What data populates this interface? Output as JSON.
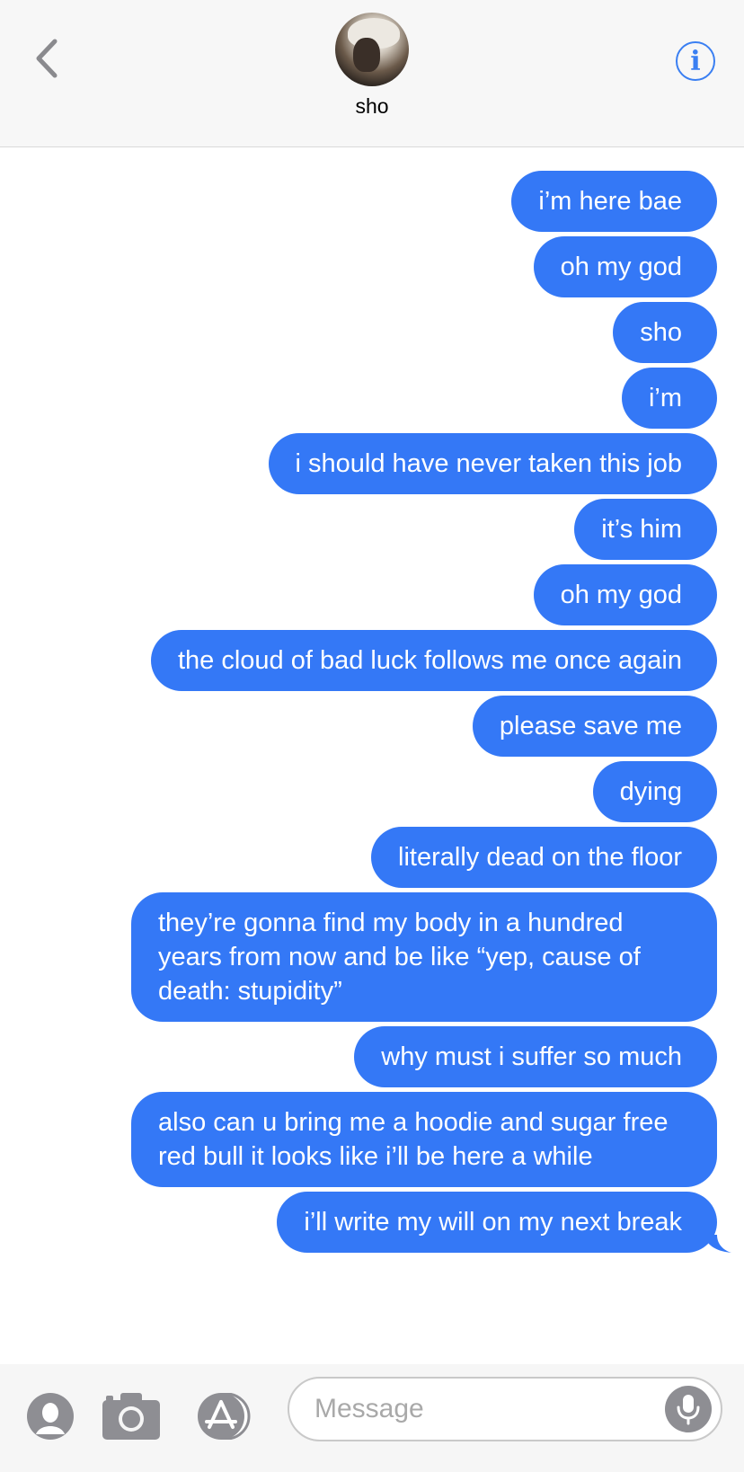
{
  "header": {
    "contact_name": "sho",
    "back_icon": "chevron-left-icon",
    "info_icon": "info-icon",
    "info_glyph": "i"
  },
  "colors": {
    "bubble": "#3478f6",
    "accent": "#3a7ff2",
    "header_bg": "#f7f7f7"
  },
  "messages": [
    "i’m here bae",
    "oh my god",
    "sho",
    "i’m",
    "i should have never taken this job",
    "it’s him",
    "oh my god",
    "the cloud of bad luck follows me once again",
    "please save me",
    "dying",
    "literally dead on the floor",
    "they’re gonna find my body in a hundred years from now and be like “yep, cause of death: stupidity”",
    "why must i suffer so much",
    "also can u bring me a hoodie and sugar free red bull it looks like i’ll be here a while",
    "i’ll write my will on my next break"
  ],
  "composer": {
    "placeholder": "Message",
    "tools": [
      "memoji-icon",
      "camera-icon",
      "app-store-icon"
    ],
    "mic_icon": "microphone-icon"
  }
}
